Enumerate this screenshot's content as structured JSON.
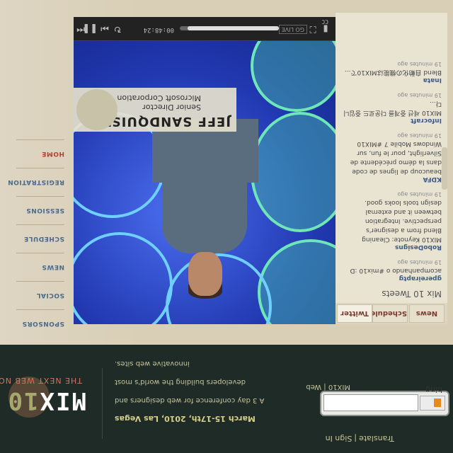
{
  "header": {
    "signin": {
      "translate": "Translate",
      "sign_in": "Sign In"
    },
    "search": {
      "button_label": "bing",
      "placeholder": "",
      "caption": "MIX10 | Web"
    },
    "conference": {
      "description": "A 3 day conference for web designers and developers building the world's most innovative web sites.",
      "date": "March 15-17th, 2010, Las Vegas"
    },
    "logo": {
      "mix": "MIX",
      "ten": "10",
      "tagline": "THE NEXT WEB NOW"
    }
  },
  "nav": {
    "items": [
      {
        "label": "HOME",
        "active": true
      },
      {
        "label": "REGISTRATION"
      },
      {
        "label": "SESSIONS"
      },
      {
        "label": "SCHEDULE"
      },
      {
        "label": "NEWS"
      },
      {
        "label": "SOCIAL"
      },
      {
        "label": "SPONSORS"
      }
    ]
  },
  "panel": {
    "tabs": [
      {
        "label": "Twitter",
        "selected": true
      },
      {
        "label": "Schedule"
      },
      {
        "label": "News"
      }
    ],
    "feed_title": "Mix 10 Tweets",
    "tweets": [
      {
        "user": "gpereiraptg",
        "text": "acompanhando o #mix10 :D",
        "time": "19 minutes ago"
      },
      {
        "user": "RoboDesigns",
        "text": "MIX10 Keynote: Cleaning Blend from a designer's perspective. Integration between it and external design tools looks good.",
        "time": "19 minutes ago"
      },
      {
        "user": "KDFA",
        "text": "beaucoup de lignes de code dans la démo précédente de Silverlight, pour le fun, sur Windows Mobile 7 #MIX10",
        "time": "19 minutes ago"
      },
      {
        "user": "Infocraft",
        "text": "MIX10 세션 중계를 다운로드 중입니다...",
        "time": "19 minutes ago"
      },
      {
        "user": "Inata",
        "text": "Blend 自動化の機能はMIX10で...",
        "time": "19 minutes ago"
      }
    ]
  },
  "video": {
    "speaker_name": "JEFF SANDQUIST",
    "speaker_title": "Senior Director",
    "speaker_company": "Microsoft Corporation",
    "controls": {
      "go_live": "GO LIVE",
      "time": "00:48:24",
      "progress": 0.92
    }
  },
  "colors": {
    "dark_bg": "#1e2b27",
    "beige": "#d9cfb6",
    "accent_red": "#b84030",
    "video_blue": "#1b3aa4"
  }
}
